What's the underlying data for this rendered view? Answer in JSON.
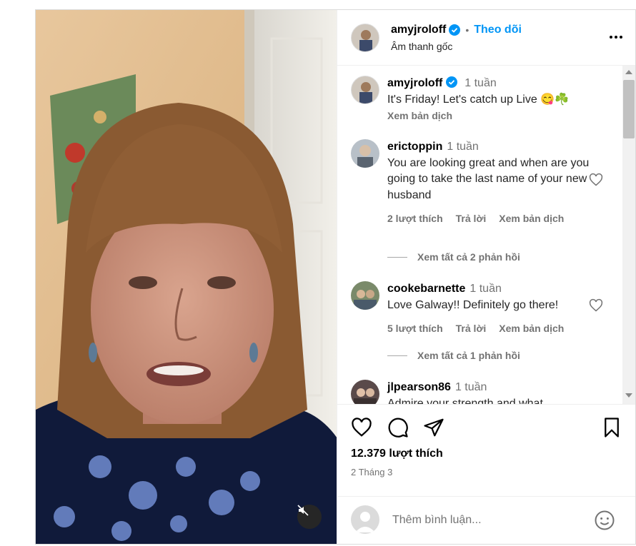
{
  "header": {
    "username": "amyjroloff",
    "dot": "•",
    "follow_label": "Theo dõi",
    "subtitle": "Âm thanh gốc",
    "verified_color": "#0095f6"
  },
  "caption": {
    "username": "amyjroloff",
    "time": "1 tuần",
    "text": "It's Friday! Let's catch up Live 😋☘️",
    "translate_label": "Xem bản dịch"
  },
  "comments": [
    {
      "username": "erictoppin",
      "time": "1 tuần",
      "text": "You are looking great and when are you going to take the last name of your new husband",
      "likes": "2 lượt thích",
      "reply_label": "Trả lời",
      "translate_label": "Xem bản dịch",
      "replies_label": "Xem tất cả 2 phản hồi"
    },
    {
      "username": "cookebarnette",
      "time": "1 tuần",
      "text": "Love Galway!! Definitely go there!",
      "likes": "5 lượt thích",
      "reply_label": "Trả lời",
      "translate_label": "Xem bản dịch",
      "replies_label": "Xem tất cả 1 phản hồi"
    },
    {
      "username": "jlpearson86",
      "time": "1 tuần",
      "text": "Admire your strength and what"
    }
  ],
  "actions": {
    "icons": [
      "heart-icon",
      "comment-icon",
      "share-icon",
      "bookmark-icon"
    ],
    "likes": "12.379 lượt thích",
    "date": "2 Tháng 3"
  },
  "composer": {
    "placeholder": "Thêm bình luận...",
    "emoji_icon": "smiley-icon"
  },
  "media": {
    "mute_icon": "speaker-muted-icon"
  }
}
